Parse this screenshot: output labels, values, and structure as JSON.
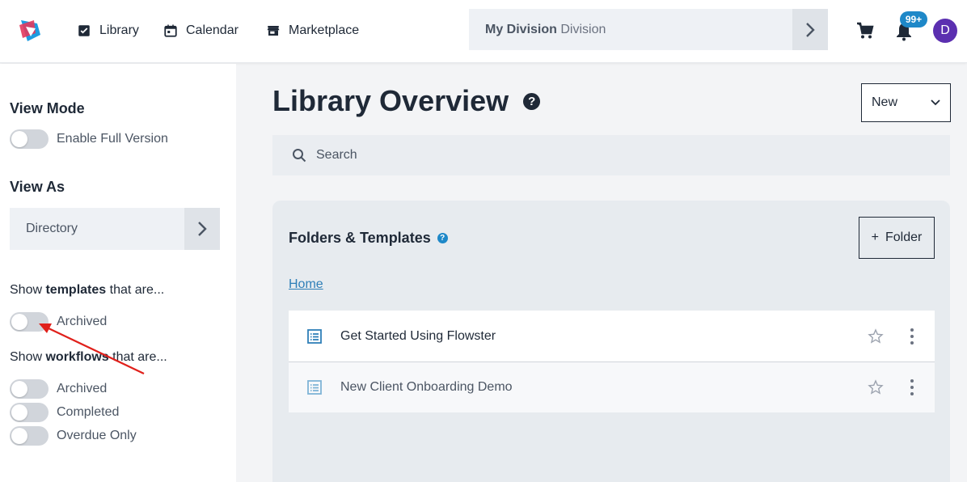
{
  "topbar": {
    "nav": [
      {
        "label": "Library",
        "icon": "checklist-icon"
      },
      {
        "label": "Calendar",
        "icon": "calendar-icon"
      },
      {
        "label": "Marketplace",
        "icon": "store-icon"
      }
    ],
    "division_bold": "My Division",
    "division_rest": "Division",
    "notification_count": "99+",
    "avatar_initial": "D"
  },
  "sidebar": {
    "view_mode_heading": "View Mode",
    "enable_full_version": "Enable Full Version",
    "view_as_heading": "View As",
    "view_as_value": "Directory",
    "templates_prefix": "Show ",
    "templates_bold": "templates",
    "templates_suffix": " that are...",
    "templates_archived": "Archived",
    "workflows_prefix": "Show ",
    "workflows_bold": "workflows",
    "workflows_suffix": " that are...",
    "workflows_archived": "Archived",
    "workflows_completed": "Completed",
    "workflows_overdue": "Overdue Only"
  },
  "main": {
    "title": "Library Overview",
    "new_select": "New",
    "search_placeholder": "Search",
    "panel_title": "Folders & Templates",
    "folder_button": "Folder",
    "breadcrumb": "Home",
    "templates": [
      {
        "name": "Get Started Using Flowster"
      },
      {
        "name": "New Client Onboarding Demo"
      }
    ]
  },
  "colors": {
    "accent": "#1e88c8",
    "avatar": "#5b2fb0",
    "annotation_arrow": "#e0201b"
  }
}
